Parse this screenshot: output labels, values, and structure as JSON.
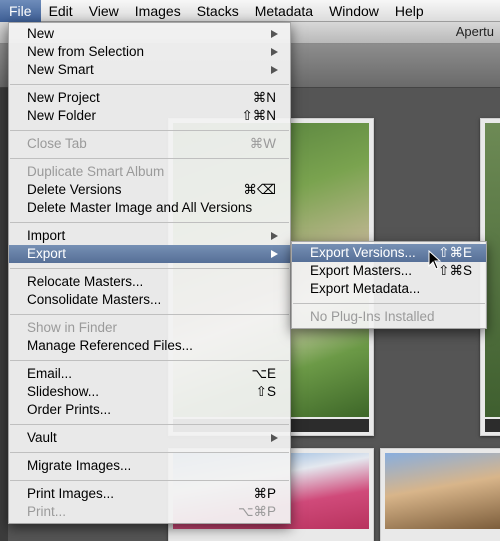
{
  "menubar": {
    "items": [
      "File",
      "Edit",
      "View",
      "Images",
      "Stacks",
      "Metadata",
      "Window",
      "Help"
    ],
    "active_index": 0
  },
  "app": {
    "title": "Apertu"
  },
  "file_menu": {
    "items": [
      {
        "type": "item",
        "label": "New",
        "submenu": true
      },
      {
        "type": "item",
        "label": "New from Selection",
        "submenu": true
      },
      {
        "type": "item",
        "label": "New Smart",
        "submenu": true
      },
      {
        "type": "sep"
      },
      {
        "type": "item",
        "label": "New Project",
        "shortcut": "⌘N"
      },
      {
        "type": "item",
        "label": "New Folder",
        "shortcut": "⇧⌘N"
      },
      {
        "type": "sep"
      },
      {
        "type": "item",
        "label": "Close Tab",
        "shortcut": "⌘W",
        "disabled": true
      },
      {
        "type": "sep"
      },
      {
        "type": "item",
        "label": "Duplicate Smart Album",
        "disabled": true
      },
      {
        "type": "item",
        "label": "Delete Versions",
        "shortcut": "⌘⌫"
      },
      {
        "type": "item",
        "label": "Delete Master Image and All Versions"
      },
      {
        "type": "sep"
      },
      {
        "type": "item",
        "label": "Import",
        "submenu": true
      },
      {
        "type": "item",
        "label": "Export",
        "submenu": true,
        "highlight": true
      },
      {
        "type": "sep"
      },
      {
        "type": "item",
        "label": "Relocate Masters..."
      },
      {
        "type": "item",
        "label": "Consolidate Masters..."
      },
      {
        "type": "sep"
      },
      {
        "type": "item",
        "label": "Show in Finder",
        "disabled": true
      },
      {
        "type": "item",
        "label": "Manage Referenced Files..."
      },
      {
        "type": "sep"
      },
      {
        "type": "item",
        "label": "Email...",
        "shortcut": "⌥E"
      },
      {
        "type": "item",
        "label": "Slideshow...",
        "shortcut": "⇧S"
      },
      {
        "type": "item",
        "label": "Order Prints..."
      },
      {
        "type": "sep"
      },
      {
        "type": "item",
        "label": "Vault",
        "submenu": true
      },
      {
        "type": "sep"
      },
      {
        "type": "item",
        "label": "Migrate Images..."
      },
      {
        "type": "sep"
      },
      {
        "type": "item",
        "label": "Print Images...",
        "shortcut": "⌘P"
      },
      {
        "type": "item",
        "label": "Print...",
        "shortcut": "⌥⌘P",
        "disabled": true
      }
    ]
  },
  "export_submenu": {
    "items": [
      {
        "type": "item",
        "label": "Export Versions...",
        "shortcut": "⇧⌘E",
        "highlight": true
      },
      {
        "type": "item",
        "label": "Export Masters...",
        "shortcut": "⇧⌘S"
      },
      {
        "type": "item",
        "label": "Export Metadata..."
      },
      {
        "type": "sep"
      },
      {
        "type": "item",
        "label": "No Plug-Ins Installed",
        "disabled": true
      }
    ]
  },
  "colors": {
    "menu_highlight": "#5f7aa3",
    "menubar_active": "#4a6aa0",
    "disabled_text": "#9a9a9a"
  }
}
